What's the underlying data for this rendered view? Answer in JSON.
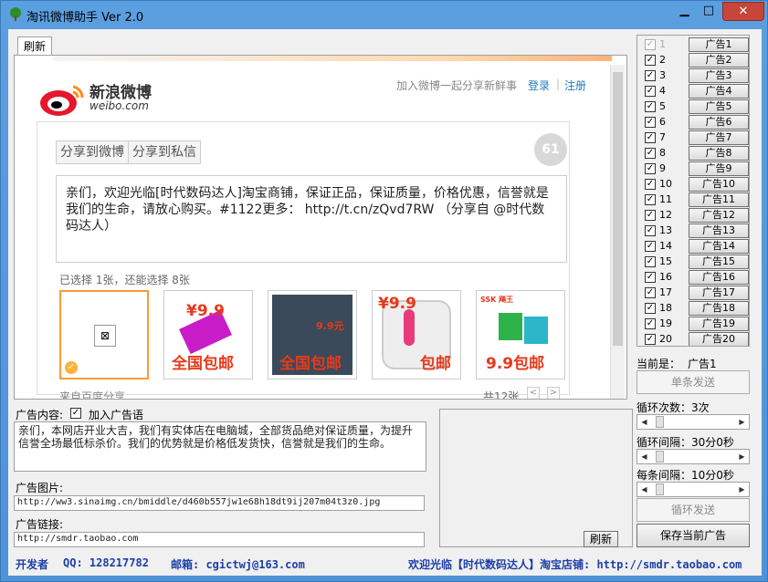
{
  "window": {
    "title": "淘讯微博助手 Ver 2.0"
  },
  "browser": {
    "tab_label": "刷新",
    "brand": "新浪微博",
    "brand_sub": "weibo.com",
    "join_text": "加入微博一起分享新鲜事",
    "login": "登录",
    "separator": "|",
    "register": "注册",
    "share_tabs": [
      "分享到微博",
      "分享到私信"
    ],
    "char_counter": "61",
    "share_text": "亲们，欢迎光临[时代数码达人]淘宝商铺，保证正品，保证质量，价格优惠，信誉就是我们的生命，请放心购买。#1122更多： http://t.cn/zQvd7RW （分享自 @时代数码达人）",
    "chosen_info": "已选择 1张，还能选择 8张",
    "thumbnails": [
      {
        "promo": "",
        "price": ""
      },
      {
        "promo": "全国包邮",
        "price": "¥9.9"
      },
      {
        "promo": "全国包邮",
        "price": "9.9元"
      },
      {
        "promo": "包邮",
        "price": "¥9.9"
      },
      {
        "promo": "9.9包邮",
        "price": "SSK 飚王"
      }
    ],
    "from_baidu": "来自百度分享",
    "total_count": "共12张",
    "pager_prev": "<",
    "pager_next": ">"
  },
  "ads": [
    {
      "num": "1",
      "label": "广告1",
      "checked": true,
      "disabled": true
    },
    {
      "num": "2",
      "label": "广告2",
      "checked": true,
      "disabled": false
    },
    {
      "num": "3",
      "label": "广告3",
      "checked": true,
      "disabled": false
    },
    {
      "num": "4",
      "label": "广告4",
      "checked": true,
      "disabled": false
    },
    {
      "num": "5",
      "label": "广告5",
      "checked": true,
      "disabled": false
    },
    {
      "num": "6",
      "label": "广告6",
      "checked": true,
      "disabled": false
    },
    {
      "num": "7",
      "label": "广告7",
      "checked": true,
      "disabled": false
    },
    {
      "num": "8",
      "label": "广告8",
      "checked": true,
      "disabled": false
    },
    {
      "num": "9",
      "label": "广告9",
      "checked": true,
      "disabled": false
    },
    {
      "num": "10",
      "label": "广告10",
      "checked": true,
      "disabled": false
    },
    {
      "num": "11",
      "label": "广告11",
      "checked": true,
      "disabled": false
    },
    {
      "num": "12",
      "label": "广告12",
      "checked": true,
      "disabled": false
    },
    {
      "num": "13",
      "label": "广告13",
      "checked": true,
      "disabled": false
    },
    {
      "num": "14",
      "label": "广告14",
      "checked": true,
      "disabled": false
    },
    {
      "num": "15",
      "label": "广告15",
      "checked": true,
      "disabled": false
    },
    {
      "num": "16",
      "label": "广告16",
      "checked": true,
      "disabled": false
    },
    {
      "num": "17",
      "label": "广告17",
      "checked": true,
      "disabled": false
    },
    {
      "num": "18",
      "label": "广告18",
      "checked": true,
      "disabled": false
    },
    {
      "num": "19",
      "label": "广告19",
      "checked": true,
      "disabled": false
    },
    {
      "num": "20",
      "label": "广告20",
      "checked": true,
      "disabled": false
    }
  ],
  "controls": {
    "current_label": "当前是：",
    "current_value": "广告1",
    "single_send": "单条发送",
    "loop_count_label": "循环次数：3次",
    "loop_interval_label": "循环间隔：30分0秒",
    "each_interval_label": "每条间隔：10分0秒",
    "loop_send": "循环发送",
    "save_current": "保存当前广告",
    "loop_count_level": 0.05,
    "loop_interval_level": 0.05,
    "each_interval_level": 0.05
  },
  "editor": {
    "ad_content_label": "广告内容:",
    "add_slogan_label": "加入广告语",
    "add_slogan_checked": true,
    "ad_content": "亲们，本网店开业大吉，我们有实体店在电脑城，全部货品绝对保证质量，为提升信誉全场最低标杀价。我们的优势就是价格低发货快，信誉就是我们的生命。",
    "ad_image_label": "广告图片:",
    "ad_image_url": "http://ww3.sinaimg.cn/bmiddle/d460b557jw1e68h18dt9ij207m04t3z0.jpg",
    "ad_link_label": "广告链接:",
    "ad_link_url": "http://smdr.taobao.com",
    "refresh_button": "刷新"
  },
  "footer": {
    "dev_label": "开发者",
    "qq": "QQ: 128217782",
    "email": "邮箱: cgictwj@163.com",
    "welcome": "欢迎光临【时代数码达人】淘宝店铺: http://smdr.taobao.com"
  },
  "colors": {
    "accent": "#1c3fa8",
    "close": "#c7463b",
    "promo": "#e6391b"
  }
}
